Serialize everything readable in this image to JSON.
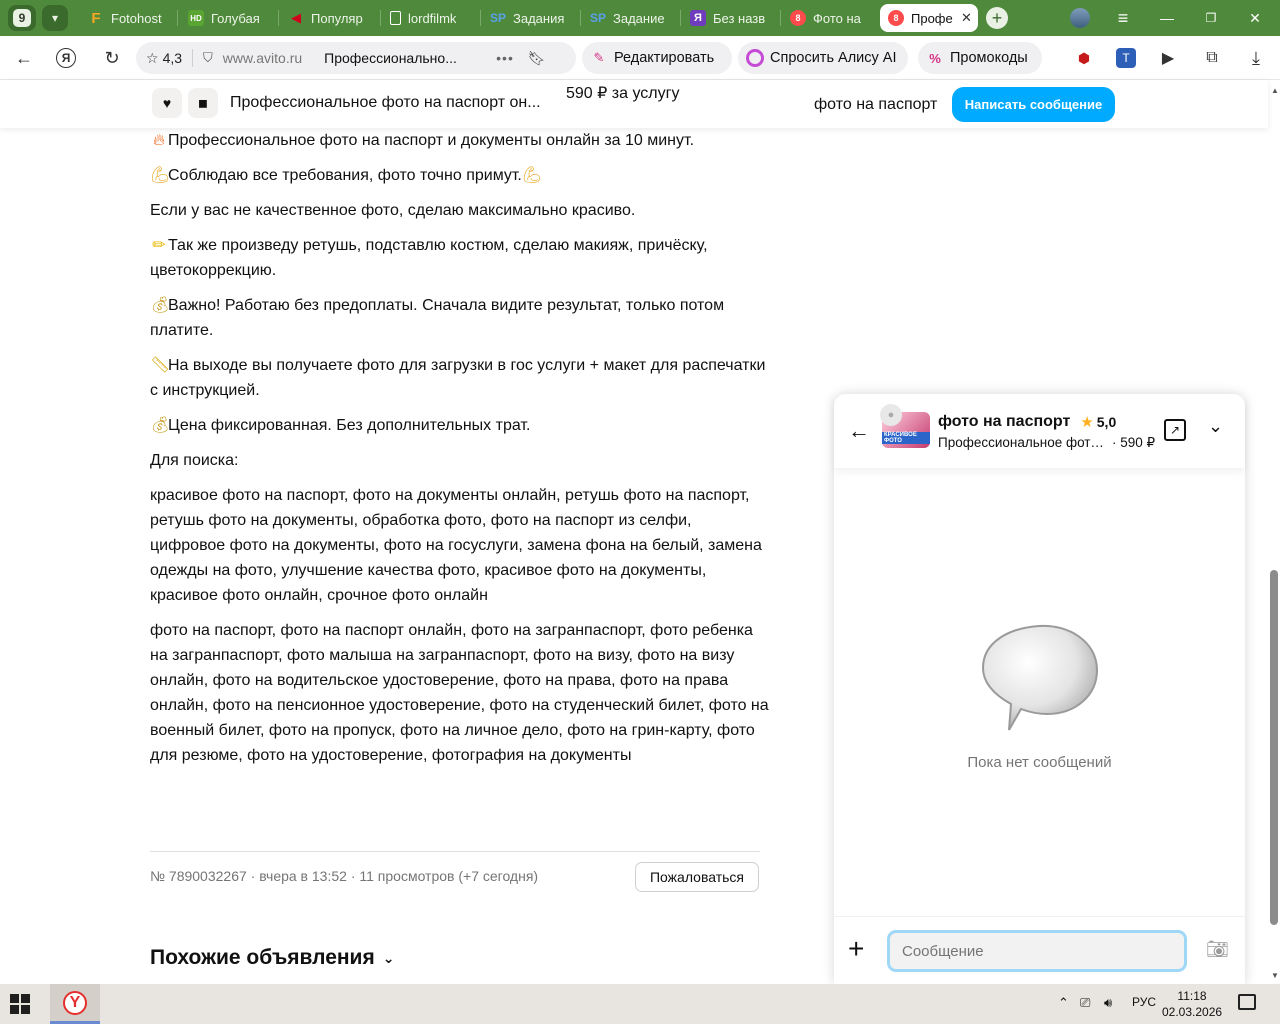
{
  "browser": {
    "tab_count": "9",
    "tabs": [
      {
        "label": "Fotohost",
        "fav": "F",
        "fav_color": "#f5a623"
      },
      {
        "label": "Голубая",
        "fav": "HD",
        "fav_color": "#5aa532"
      },
      {
        "label": "Популяр",
        "fav": "◀",
        "fav_color": "#d0021b"
      },
      {
        "label": "lordfilmk",
        "fav": "▯",
        "fav_color": "#ffffff"
      },
      {
        "label": "Задания",
        "fav": "SP",
        "fav_color": "#4a90e2"
      },
      {
        "label": "Задание",
        "fav": "SP",
        "fav_color": "#4a90e2"
      },
      {
        "label": "Без назв",
        "fav": "Я",
        "fav_color": "#6e3cbc"
      },
      {
        "label": "Фото на",
        "fav": "8",
        "fav_color": "#ff4b4b"
      },
      {
        "label": "Профе",
        "fav": "8",
        "fav_color": "#ff4b4b"
      }
    ],
    "address": {
      "rating": "4,3",
      "domain": "www.avito.ru",
      "page_title": "Профессионально..."
    },
    "toolbar_pills": {
      "edit": "Редактировать",
      "alice": "Спросить Алису AI",
      "promo": "Промокоды"
    }
  },
  "sticky": {
    "title": "Профессиональное фото на паспорт он...",
    "price": "590 ₽ за услугу",
    "seller": "фото на паспорт",
    "write_button": "Написать сообщение"
  },
  "description": {
    "p1": "Профессиональное фото на паспорт и документы онлайн за 10 минут.",
    "p2": "Соблюдаю все требования, фото точно примут.",
    "p3": "Если у вас не качественное фото, сделаю максимально красиво.",
    "p4": "Так же произведу ретушь, подставлю костюм, сделаю макияж, причёску, цветокоррекцию.",
    "p5": "Важно! Работаю без предоплаты. Сначала видите результат, только потом платите.",
    "p6": "На выходе вы получаете фото для загрузки в гос услуги + макет для распечатки с инструкцией.",
    "p7": "Цена фиксированная. Без дополнительных трат.",
    "p8": "Для поиска:",
    "p9": "красивое фото на паспорт, фото на документы онлайн, ретушь фото на паспорт, ретушь фото на документы, обработка фото, фото на паспорт из селфи, цифровое фото на документы, фото на госуслуги, замена фона на белый, замена одежды на фото, улучшение качества фото, красивое фото на документы, красивое фото онлайн, срочное фото онлайн",
    "p10": "фото на паспорт, фото на паспорт онлайн, фото на загранпаспорт, фото ребенка на загранпаспорт, фото малыша на загранпаспорт, фото на визу, фото на визу онлайн, фото на водительское удостоверение, фото на права, фото на права онлайн, фото на пенсионное удостоверение, фото на студенческий билет, фото на военный билет, фото на пропуск, фото на личное дело, фото на грин-карту, фото для резюме, фото на удостоверение, фотография на документы"
  },
  "meta": {
    "info": "№ 7890032267 · вчера в 13:52 · 11 просмотров (+7 сегодня)",
    "complain_button": "Пожаловаться"
  },
  "similar_heading": "Похожие объявления",
  "chat": {
    "seller_name": "фото на паспорт",
    "rating": "5,0",
    "item_title": "Профессиональное фото на паспорт",
    "price": "· 590 ₽",
    "empty_text": "Пока нет сообщений",
    "input_placeholder": "Сообщение",
    "avatar_text": "КРАСИВОЕ ФОТО"
  },
  "taskbar": {
    "lang": "РУС",
    "time": "11:18",
    "date": "02.03.2026"
  },
  "colors": {
    "browser_green": "#4f8a3c",
    "accent_blue": "#00aaff",
    "star": "#ffb021"
  }
}
